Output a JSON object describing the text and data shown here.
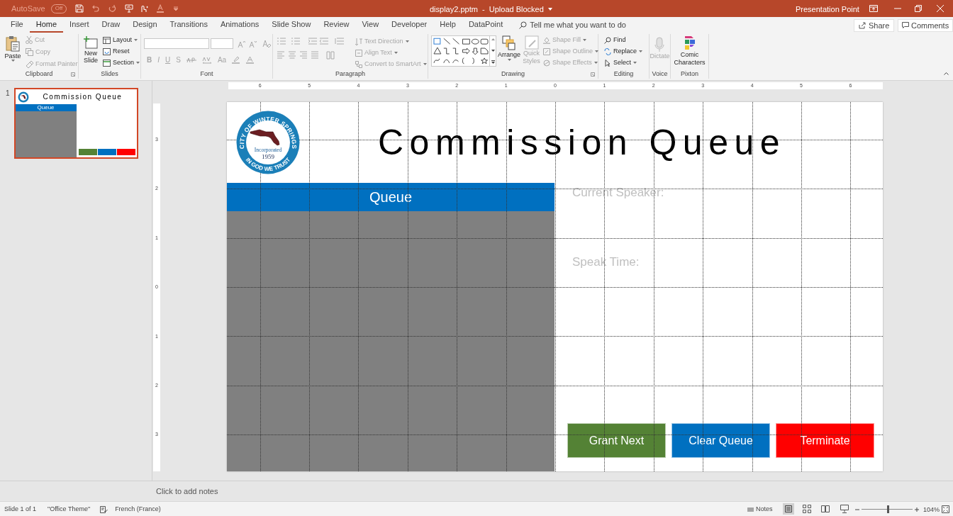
{
  "title_bar": {
    "autosave": {
      "label": "AutoSave",
      "state_text": "Off",
      "on": false
    },
    "document": "display2.pptm  -  Upload Blocked",
    "user": "Presentation Point"
  },
  "tabs": [
    {
      "label": "File",
      "selected": false
    },
    {
      "label": "Home",
      "selected": true
    },
    {
      "label": "Insert",
      "selected": false
    },
    {
      "label": "Draw",
      "selected": false
    },
    {
      "label": "Design",
      "selected": false
    },
    {
      "label": "Transitions",
      "selected": false
    },
    {
      "label": "Animations",
      "selected": false
    },
    {
      "label": "Slide Show",
      "selected": false
    },
    {
      "label": "Review",
      "selected": false
    },
    {
      "label": "View",
      "selected": false
    },
    {
      "label": "Developer",
      "selected": false
    },
    {
      "label": "Help",
      "selected": false
    },
    {
      "label": "DataPoint",
      "selected": false
    }
  ],
  "tell_me": {
    "placeholder": "Tell me what you want to do"
  },
  "share_button": "Share",
  "comments_button": "Comments",
  "ribbon": {
    "clipboard": {
      "name": "Clipboard",
      "paste": {
        "label": "Paste",
        "disabled": false
      },
      "cut": {
        "label": "Cut",
        "disabled": true
      },
      "copy": {
        "label": "Copy",
        "disabled": true
      },
      "format_painter": {
        "label": "Format Painter",
        "disabled": true
      }
    },
    "slides": {
      "name": "Slides",
      "new_slide": {
        "label": "New Slide",
        "disabled": false
      },
      "layout": {
        "label": "Layout",
        "disabled": false
      },
      "reset": {
        "label": "Reset",
        "disabled": false
      },
      "section": {
        "label": "Section",
        "disabled": false
      }
    },
    "font": {
      "name": "Font",
      "format_buttons": [
        {
          "label": "B",
          "disabled": true
        },
        {
          "label": "I",
          "disabled": true
        },
        {
          "label": "U",
          "disabled": true
        },
        {
          "label": "S",
          "disabled": true
        },
        {
          "label": "Aa",
          "disabled": true
        }
      ]
    },
    "paragraph": {
      "name": "Paragraph",
      "text_direction": {
        "label": "Text Direction",
        "disabled": true
      },
      "align_text": {
        "label": "Align Text",
        "disabled": true
      },
      "convert_smartart": {
        "label": "Convert to SmartArt",
        "disabled": true
      }
    },
    "drawing": {
      "name": "Drawing",
      "arrange": {
        "label": "Arrange",
        "disabled": false
      },
      "quick_styles": {
        "label": "Quick Styles",
        "disabled": true
      },
      "shape_fill": {
        "label": "Shape Fill",
        "disabled": true
      },
      "shape_outline": {
        "label": "Shape Outline",
        "disabled": true
      },
      "shape_effects": {
        "label": "Shape Effects",
        "disabled": true
      }
    },
    "editing": {
      "name": "Editing",
      "find": {
        "label": "Find",
        "disabled": false
      },
      "replace": {
        "label": "Replace",
        "disabled": false
      },
      "select": {
        "label": "Select",
        "disabled": false
      }
    },
    "voice": {
      "name": "Voice",
      "dictate": {
        "label": "Dictate",
        "disabled": true
      }
    },
    "pixton": {
      "name": "Pixton",
      "comic_characters": {
        "label": "Comic Characters",
        "disabled": false
      }
    }
  },
  "thumbnails": [
    {
      "number": "1",
      "selected": true,
      "title": "Commission Queue",
      "header": "Queue"
    }
  ],
  "rulers": {
    "horizontal": [
      "6",
      "5",
      "4",
      "3",
      "2",
      "1",
      "0",
      "1",
      "2",
      "3",
      "4",
      "5",
      "6"
    ],
    "vertical": [
      "3",
      "2",
      "1",
      "0",
      "1",
      "2",
      "3"
    ]
  },
  "slide": {
    "logo": {
      "ring_top": "CITY OF WINTER SPRINGS",
      "ring_bottom": "IN GOD WE TRUST",
      "incorporated": "Incorporated",
      "year": "1959"
    },
    "title": "Commission Queue",
    "queue_header": "Queue",
    "current_speaker": "Current Speaker:",
    "speak_time": "Speak Time:",
    "buttons": [
      {
        "label": "Grant Next",
        "color": "#548235"
      },
      {
        "label": "Clear Queue",
        "color": "#0070c0"
      },
      {
        "label": "Terminate",
        "color": "#ff0000"
      }
    ]
  },
  "notes": {
    "placeholder": "Click to add notes"
  },
  "status_bar": {
    "slide_info": "Slide 1 of 1",
    "theme": "\"Office Theme\"",
    "language": "French (France)",
    "notes_button": "Notes",
    "zoom_slider": {
      "level": 0.52
    },
    "zoom_percent": "104%"
  }
}
